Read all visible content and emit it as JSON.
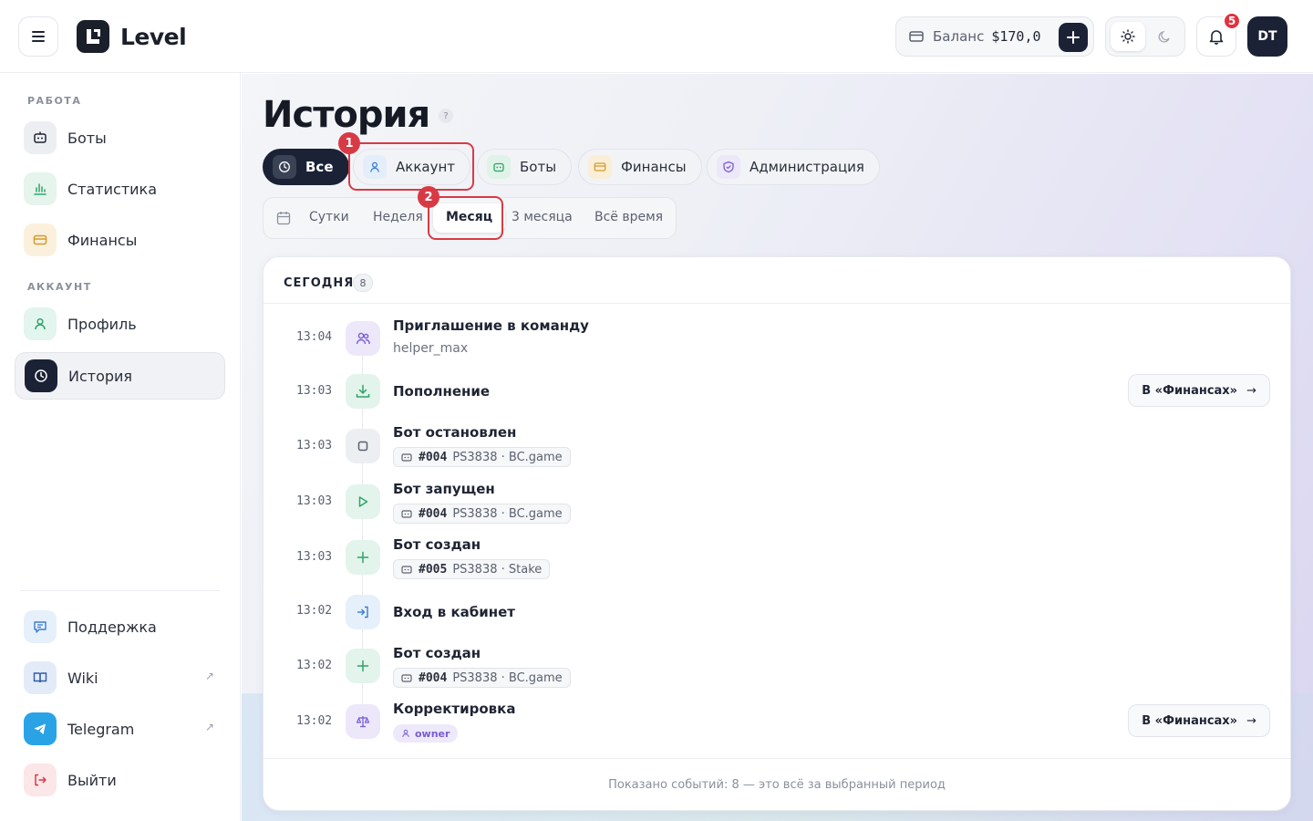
{
  "app": {
    "name": "Level"
  },
  "header": {
    "balance_label": "Баланс",
    "balance_value": "$170,0",
    "notifications_count": "5",
    "avatar_initials": "DT"
  },
  "sidebar": {
    "sections": [
      {
        "title": "РАБОТА",
        "items": [
          {
            "label": "Боты",
            "icon": "bot-icon"
          },
          {
            "label": "Статистика",
            "icon": "chart-icon"
          },
          {
            "label": "Финансы",
            "icon": "wallet-icon"
          }
        ]
      },
      {
        "title": "АККАУНТ",
        "items": [
          {
            "label": "Профиль",
            "icon": "user-icon"
          },
          {
            "label": "История",
            "icon": "clock-icon",
            "active": true
          }
        ]
      }
    ],
    "bottom": [
      {
        "label": "Поддержка",
        "icon": "chat-icon"
      },
      {
        "label": "Wiki",
        "icon": "book-icon",
        "external": true
      },
      {
        "label": "Telegram",
        "icon": "telegram-icon",
        "external": true
      },
      {
        "label": "Выйти",
        "icon": "logout-icon"
      }
    ]
  },
  "page": {
    "title": "История",
    "help": "?",
    "categories": [
      {
        "label": "Все",
        "active": true
      },
      {
        "label": "Аккаунт"
      },
      {
        "label": "Боты"
      },
      {
        "label": "Финансы"
      },
      {
        "label": "Администрация"
      }
    ],
    "periods": [
      {
        "label": "Сутки"
      },
      {
        "label": "Неделя"
      },
      {
        "label": "Месяц",
        "active": true
      },
      {
        "label": "3 месяца"
      },
      {
        "label": "Всё время"
      }
    ],
    "markers": [
      "1",
      "2"
    ]
  },
  "events_card": {
    "group_title": "СЕГОДНЯ",
    "group_count": "8",
    "events": [
      {
        "time": "13:04",
        "title": "Приглашение в команду",
        "sub": "helper_max",
        "icon": "users-icon"
      },
      {
        "time": "13:03",
        "title": "Пополнение",
        "icon": "download-icon",
        "action": "В «Финансах»"
      },
      {
        "time": "13:03",
        "title": "Бот остановлен",
        "icon": "stop-icon",
        "tag_id": "#004",
        "tag_text": "PS3838 · BC.game"
      },
      {
        "time": "13:03",
        "title": "Бот запущен",
        "icon": "play-icon",
        "tag_id": "#004",
        "tag_text": "PS3838 · BC.game"
      },
      {
        "time": "13:03",
        "title": "Бот создан",
        "icon": "plus-icon",
        "tag_id": "#005",
        "tag_text": "PS3838 · Stake"
      },
      {
        "time": "13:02",
        "title": "Вход в кабинет",
        "icon": "login-icon"
      },
      {
        "time": "13:02",
        "title": "Бот создан",
        "icon": "plus-icon",
        "tag_id": "#004",
        "tag_text": "PS3838 · BC.game"
      },
      {
        "time": "13:02",
        "title": "Корректировка",
        "icon": "scale-icon",
        "role": "owner",
        "action": "В «Финансах»"
      }
    ],
    "footer": "Показано событий: 8 — это всё за выбранный период"
  },
  "colors": {
    "dark_accent": "#1b2236",
    "highlight_red": "#d83a45",
    "green_icon": "#2ea36b",
    "purple_icon": "#7a5cd6"
  }
}
